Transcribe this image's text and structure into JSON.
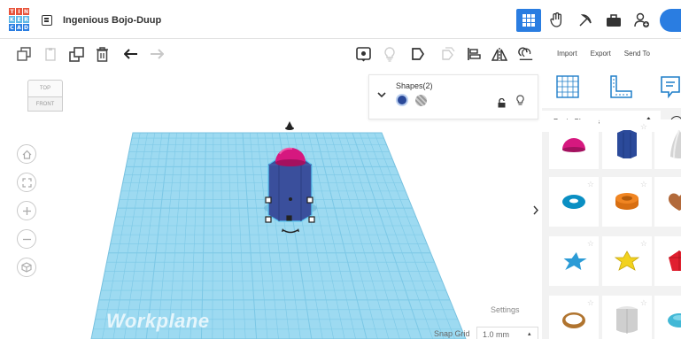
{
  "app": {
    "logo_letters": [
      "T",
      "I",
      "N",
      "K",
      "E",
      "R",
      "C",
      "A",
      "D"
    ],
    "logo_colors": [
      "#e8533a",
      "#e8533a",
      "#e8533a",
      "#5db7e7",
      "#5db7e7",
      "#5db7e7",
      "#2a7de1",
      "#2a7de1",
      "#2a7de1"
    ],
    "design_title": "Ingenious Bojo-Duup"
  },
  "header_icons": [
    "grid-view-icon",
    "hand-pointer-icon",
    "pickaxe-icon",
    "briefcase-icon",
    "add-user-icon"
  ],
  "toolbar": {
    "left_icons": [
      "copy-icon",
      "paste-icon",
      "duplicate-icon",
      "delete-icon",
      "undo-icon",
      "redo-icon"
    ],
    "right_icons": [
      "notes-icon",
      "light-bulb-icon",
      "hide-icon",
      "show-all-icon",
      "align-icon",
      "mirror-icon",
      "group-icon"
    ]
  },
  "panel_tabs": [
    "Import",
    "Export",
    "Send To"
  ],
  "viewcube": {
    "top": "TOP",
    "front": "FRONT"
  },
  "shapes_inspector": {
    "title": "Shapes(2)",
    "solid_color": "#2b4a9a"
  },
  "viewport": {
    "workplane_label": "Workplane",
    "settings_label": "Settings",
    "snap_grid_label": "Snap Grid",
    "snap_grid_value": "1.0 mm",
    "grid_color": "#8fd3ee",
    "shape_color": "#3a4f9c",
    "dome_color": "#d6187f"
  },
  "library": {
    "category": "Basic Shapes",
    "shapes": [
      {
        "name": "half-sphere",
        "color": "#d6187f"
      },
      {
        "name": "polygon",
        "color": "#2b4a9a"
      },
      {
        "name": "paraboloid",
        "color": "#d4d4d4"
      },
      {
        "name": "torus",
        "color": "#0a8fc3"
      },
      {
        "name": "tube",
        "color": "#f08522"
      },
      {
        "name": "heart",
        "color": "#b26a3b"
      },
      {
        "name": "star",
        "color": "#2b9bd6"
      },
      {
        "name": "star-yellow",
        "color": "#f2d21e"
      },
      {
        "name": "gem",
        "color": "#e0202f"
      },
      {
        "name": "ring",
        "color": "#b0742f"
      },
      {
        "name": "round-roof",
        "color": "#cfcfcf"
      },
      {
        "name": "diamond",
        "color": "#42b8d6"
      }
    ]
  }
}
